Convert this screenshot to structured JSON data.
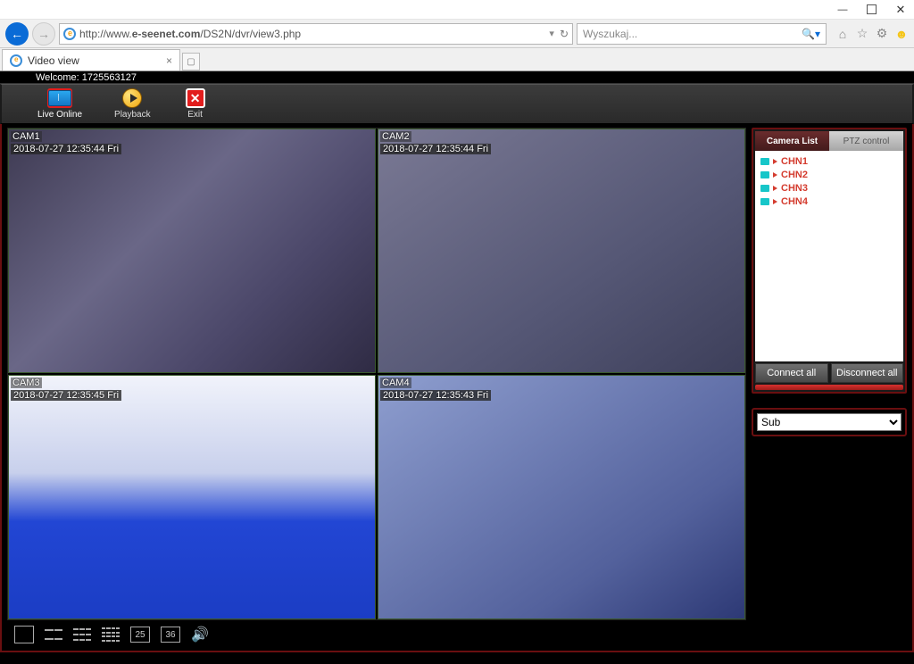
{
  "browser": {
    "url_domain": "e-seenet.com",
    "url_rest": "/DS2N/dvr/view3.php",
    "url_prefix": "http://www.",
    "tab_title": "Video view",
    "search_placeholder": "Wyszukaj..."
  },
  "app": {
    "welcome": "Welcome: 1725563127",
    "toolbar": {
      "live": "Live Online",
      "playback": "Playback",
      "exit": "Exit"
    },
    "camera_panel": {
      "tab_list": "Camera List",
      "tab_ptz": "PTZ control",
      "channels": [
        {
          "label": "CHN1"
        },
        {
          "label": "CHN2"
        },
        {
          "label": "CHN3"
        },
        {
          "label": "CHN4"
        }
      ],
      "connect_all": "Connect all",
      "disconnect_all": "Disconnect all",
      "stream_mode": "Sub"
    },
    "layout_numbers": {
      "n25": "25",
      "n36": "36"
    },
    "cams": [
      {
        "name": "CAM1",
        "ts": "2018-07-27 12:35:44 Fri"
      },
      {
        "name": "CAM2",
        "ts": "2018-07-27 12:35:44 Fri"
      },
      {
        "name": "CAM3",
        "ts": "2018-07-27 12:35:45 Fri"
      },
      {
        "name": "CAM4",
        "ts": "2018-07-27 12:35:43 Fri"
      }
    ]
  }
}
